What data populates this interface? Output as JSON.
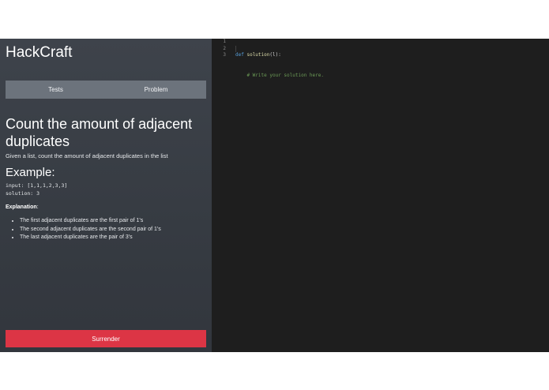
{
  "app": {
    "brand": "HackCraft"
  },
  "tabs": [
    {
      "label": "Tests"
    },
    {
      "label": "Problem"
    }
  ],
  "problem": {
    "title": "Count the amount of adjacent duplicates",
    "description": "Given a list, count the amount of adjacent duplicates in the list",
    "example_heading": "Example:",
    "example_input": "input: [1,1,1,2,3,3]",
    "example_solution": "solution: 3",
    "explanation_label": "Explanation",
    "explanation_colon": ":",
    "explanation_items": [
      "The first adjacent duplicates are the first pair of 1's",
      "The second adjacent duplicates are the second pair of 1's",
      "The last adjacent duplicates are the pair of 3's"
    ]
  },
  "actions": {
    "surrender_label": "Surrender"
  },
  "editor": {
    "line_numbers": [
      "1",
      "2",
      "3"
    ],
    "line1_keyword": "def",
    "line1_name": "solution",
    "line1_rest": "(l):",
    "line2_comment": "# Write your solution here."
  },
  "colors": {
    "panel_bg": "#3a3f46",
    "tab_bg": "#6c737c",
    "danger": "#dc3545",
    "editor_bg": "#1e1e1e"
  }
}
